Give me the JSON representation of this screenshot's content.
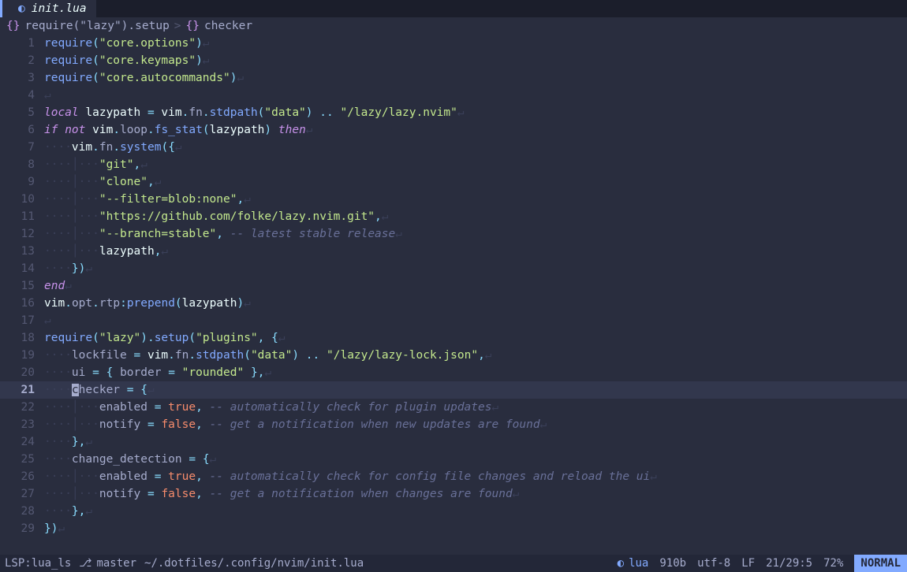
{
  "tab": {
    "icon": "◐",
    "name": "init.lua"
  },
  "winbar": {
    "brace": "{}",
    "seg1": "require(\"lazy\").setup",
    "chev": ">",
    "seg2": "{}",
    "seg3": "checker"
  },
  "lines": [
    {
      "n": "1",
      "ws": "",
      "tokens": [
        [
          "fn",
          "require"
        ],
        [
          "punc",
          "("
        ],
        [
          "str",
          "\"core.options\""
        ],
        [
          "punc",
          ")"
        ]
      ],
      "eol": "↵"
    },
    {
      "n": "2",
      "ws": "",
      "tokens": [
        [
          "fn",
          "require"
        ],
        [
          "punc",
          "("
        ],
        [
          "str",
          "\"core.keymaps\""
        ],
        [
          "punc",
          ")"
        ]
      ],
      "eol": "↵"
    },
    {
      "n": "3",
      "ws": "",
      "tokens": [
        [
          "fn",
          "require"
        ],
        [
          "punc",
          "("
        ],
        [
          "str",
          "\"core.autocommands\""
        ],
        [
          "punc",
          ")"
        ]
      ],
      "eol": "↵"
    },
    {
      "n": "4",
      "ws": "",
      "tokens": [],
      "eol": "↵"
    },
    {
      "n": "5",
      "ws": "",
      "tokens": [
        [
          "kw",
          "local"
        ],
        [
          "var",
          " lazypath "
        ],
        [
          "op",
          "="
        ],
        [
          "var",
          " vim"
        ],
        [
          "punc",
          "."
        ],
        [
          "prop",
          "fn"
        ],
        [
          "punc",
          "."
        ],
        [
          "fn",
          "stdpath"
        ],
        [
          "punc",
          "("
        ],
        [
          "str",
          "\"data\""
        ],
        [
          "punc",
          ")"
        ],
        [
          "var",
          " "
        ],
        [
          "op",
          ".."
        ],
        [
          "var",
          " "
        ],
        [
          "str",
          "\"/lazy/lazy.nvim\""
        ]
      ],
      "eol": "↵"
    },
    {
      "n": "6",
      "ws": "",
      "tokens": [
        [
          "kw",
          "if"
        ],
        [
          "var",
          " "
        ],
        [
          "kw",
          "not"
        ],
        [
          "var",
          " vim"
        ],
        [
          "punc",
          "."
        ],
        [
          "prop",
          "loop"
        ],
        [
          "punc",
          "."
        ],
        [
          "fn",
          "fs_stat"
        ],
        [
          "punc",
          "("
        ],
        [
          "var",
          "lazypath"
        ],
        [
          "punc",
          ")"
        ],
        [
          "var",
          " "
        ],
        [
          "kw",
          "then"
        ]
      ],
      "eol": "↵"
    },
    {
      "n": "7",
      "ws": "····",
      "tokens": [
        [
          "var",
          "vim"
        ],
        [
          "punc",
          "."
        ],
        [
          "prop",
          "fn"
        ],
        [
          "punc",
          "."
        ],
        [
          "fn",
          "system"
        ],
        [
          "punc",
          "("
        ],
        [
          "punc",
          "{"
        ]
      ],
      "eol": "↵"
    },
    {
      "n": "8",
      "ws": "····│···",
      "tokens": [
        [
          "str",
          "\"git\""
        ],
        [
          "punc",
          ","
        ]
      ],
      "eol": "↵"
    },
    {
      "n": "9",
      "ws": "····│···",
      "tokens": [
        [
          "str",
          "\"clone\""
        ],
        [
          "punc",
          ","
        ]
      ],
      "eol": "↵"
    },
    {
      "n": "10",
      "ws": "····│···",
      "tokens": [
        [
          "str",
          "\"--filter=blob:none\""
        ],
        [
          "punc",
          ","
        ]
      ],
      "eol": "↵"
    },
    {
      "n": "11",
      "ws": "····│···",
      "tokens": [
        [
          "str",
          "\"https://github.com/folke/lazy.nvim.git\""
        ],
        [
          "punc",
          ","
        ]
      ],
      "eol": "↵"
    },
    {
      "n": "12",
      "ws": "····│···",
      "tokens": [
        [
          "str",
          "\"--branch=stable\""
        ],
        [
          "punc",
          ","
        ],
        [
          "var",
          " "
        ],
        [
          "cmt",
          "-- latest stable release"
        ]
      ],
      "eol": "↵"
    },
    {
      "n": "13",
      "ws": "····│···",
      "tokens": [
        [
          "var",
          "lazypath"
        ],
        [
          "punc",
          ","
        ]
      ],
      "eol": "↵"
    },
    {
      "n": "14",
      "ws": "····",
      "tokens": [
        [
          "punc",
          "}"
        ],
        [
          "punc",
          ")"
        ]
      ],
      "eol": "↵"
    },
    {
      "n": "15",
      "ws": "",
      "tokens": [
        [
          "kw",
          "end"
        ]
      ],
      "eol": "↵"
    },
    {
      "n": "16",
      "ws": "",
      "tokens": [
        [
          "var",
          "vim"
        ],
        [
          "punc",
          "."
        ],
        [
          "prop",
          "opt"
        ],
        [
          "punc",
          "."
        ],
        [
          "prop",
          "rtp"
        ],
        [
          "punc",
          ":"
        ],
        [
          "fn",
          "prepend"
        ],
        [
          "punc",
          "("
        ],
        [
          "var",
          "lazypath"
        ],
        [
          "punc",
          ")"
        ]
      ],
      "eol": "↵"
    },
    {
      "n": "17",
      "ws": "",
      "tokens": [],
      "eol": "↵"
    },
    {
      "n": "18",
      "ws": "",
      "tokens": [
        [
          "fn",
          "require"
        ],
        [
          "punc",
          "("
        ],
        [
          "str",
          "\"lazy\""
        ],
        [
          "punc",
          ")"
        ],
        [
          "punc",
          "."
        ],
        [
          "fn",
          "setup"
        ],
        [
          "punc",
          "("
        ],
        [
          "str",
          "\"plugins\""
        ],
        [
          "punc",
          ","
        ],
        [
          "var",
          " "
        ],
        [
          "punc",
          "{"
        ]
      ],
      "eol": "↵"
    },
    {
      "n": "19",
      "ws": "····",
      "tokens": [
        [
          "prop",
          "lockfile"
        ],
        [
          "var",
          " "
        ],
        [
          "op",
          "="
        ],
        [
          "var",
          " vim"
        ],
        [
          "punc",
          "."
        ],
        [
          "prop",
          "fn"
        ],
        [
          "punc",
          "."
        ],
        [
          "fn",
          "stdpath"
        ],
        [
          "punc",
          "("
        ],
        [
          "str",
          "\"data\""
        ],
        [
          "punc",
          ")"
        ],
        [
          "var",
          " "
        ],
        [
          "op",
          ".."
        ],
        [
          "var",
          " "
        ],
        [
          "str",
          "\"/lazy/lazy-lock.json\""
        ],
        [
          "punc",
          ","
        ]
      ],
      "eol": "↵"
    },
    {
      "n": "20",
      "ws": "····",
      "tokens": [
        [
          "prop",
          "ui"
        ],
        [
          "var",
          " "
        ],
        [
          "op",
          "="
        ],
        [
          "var",
          " "
        ],
        [
          "punc",
          "{"
        ],
        [
          "var",
          " "
        ],
        [
          "prop",
          "border"
        ],
        [
          "var",
          " "
        ],
        [
          "op",
          "="
        ],
        [
          "var",
          " "
        ],
        [
          "str",
          "\"rounded\""
        ],
        [
          "var",
          " "
        ],
        [
          "punc",
          "}"
        ],
        [
          "punc",
          ","
        ]
      ],
      "eol": "↵"
    },
    {
      "n": "21",
      "curr": true,
      "ws": "····",
      "tokens": [
        [
          "cursor",
          "c"
        ],
        [
          "prop",
          "hecker"
        ],
        [
          "var",
          " "
        ],
        [
          "op",
          "="
        ],
        [
          "var",
          " "
        ],
        [
          "punc",
          "{"
        ]
      ],
      "eol": "↵"
    },
    {
      "n": "22",
      "ws": "····│···",
      "tokens": [
        [
          "prop",
          "enabled"
        ],
        [
          "var",
          " "
        ],
        [
          "op",
          "="
        ],
        [
          "var",
          " "
        ],
        [
          "bool",
          "true"
        ],
        [
          "punc",
          ","
        ],
        [
          "var",
          " "
        ],
        [
          "cmt",
          "-- automatically check for plugin updates"
        ]
      ],
      "eol": "↵"
    },
    {
      "n": "23",
      "ws": "····│···",
      "tokens": [
        [
          "prop",
          "notify"
        ],
        [
          "var",
          " "
        ],
        [
          "op",
          "="
        ],
        [
          "var",
          " "
        ],
        [
          "bool",
          "false"
        ],
        [
          "punc",
          ","
        ],
        [
          "var",
          " "
        ],
        [
          "cmt",
          "-- get a notification when new updates are found"
        ]
      ],
      "eol": "↵"
    },
    {
      "n": "24",
      "ws": "····",
      "tokens": [
        [
          "punc",
          "}"
        ],
        [
          "punc",
          ","
        ]
      ],
      "eol": "↵"
    },
    {
      "n": "25",
      "ws": "····",
      "tokens": [
        [
          "prop",
          "change_detection"
        ],
        [
          "var",
          " "
        ],
        [
          "op",
          "="
        ],
        [
          "var",
          " "
        ],
        [
          "punc",
          "{"
        ]
      ],
      "eol": "↵"
    },
    {
      "n": "26",
      "ws": "····│···",
      "tokens": [
        [
          "prop",
          "enabled"
        ],
        [
          "var",
          " "
        ],
        [
          "op",
          "="
        ],
        [
          "var",
          " "
        ],
        [
          "bool",
          "true"
        ],
        [
          "punc",
          ","
        ],
        [
          "var",
          " "
        ],
        [
          "cmt",
          "-- automatically check for config file changes and reload the ui"
        ]
      ],
      "eol": "↵"
    },
    {
      "n": "27",
      "ws": "····│···",
      "tokens": [
        [
          "prop",
          "notify"
        ],
        [
          "var",
          " "
        ],
        [
          "op",
          "="
        ],
        [
          "var",
          " "
        ],
        [
          "bool",
          "false"
        ],
        [
          "punc",
          ","
        ],
        [
          "var",
          " "
        ],
        [
          "cmt",
          "-- get a notification when changes are found"
        ]
      ],
      "eol": "↵"
    },
    {
      "n": "28",
      "ws": "····",
      "tokens": [
        [
          "punc",
          "}"
        ],
        [
          "punc",
          ","
        ]
      ],
      "eol": "↵"
    },
    {
      "n": "29",
      "ws": "",
      "tokens": [
        [
          "punc",
          "}"
        ],
        [
          "punc",
          ")"
        ]
      ],
      "eol": "↵"
    }
  ],
  "status": {
    "lsp": "LSP:lua_ls",
    "branch_icon": "⎇",
    "branch": "master",
    "path": "~/.dotfiles/.config/nvim/init.lua",
    "ft_icon": "◐",
    "ft": "lua",
    "size": "910b",
    "enc": "utf-8",
    "ff": "LF",
    "pos": "21/29:5",
    "pct": "72%",
    "mode": "NORMAL"
  }
}
